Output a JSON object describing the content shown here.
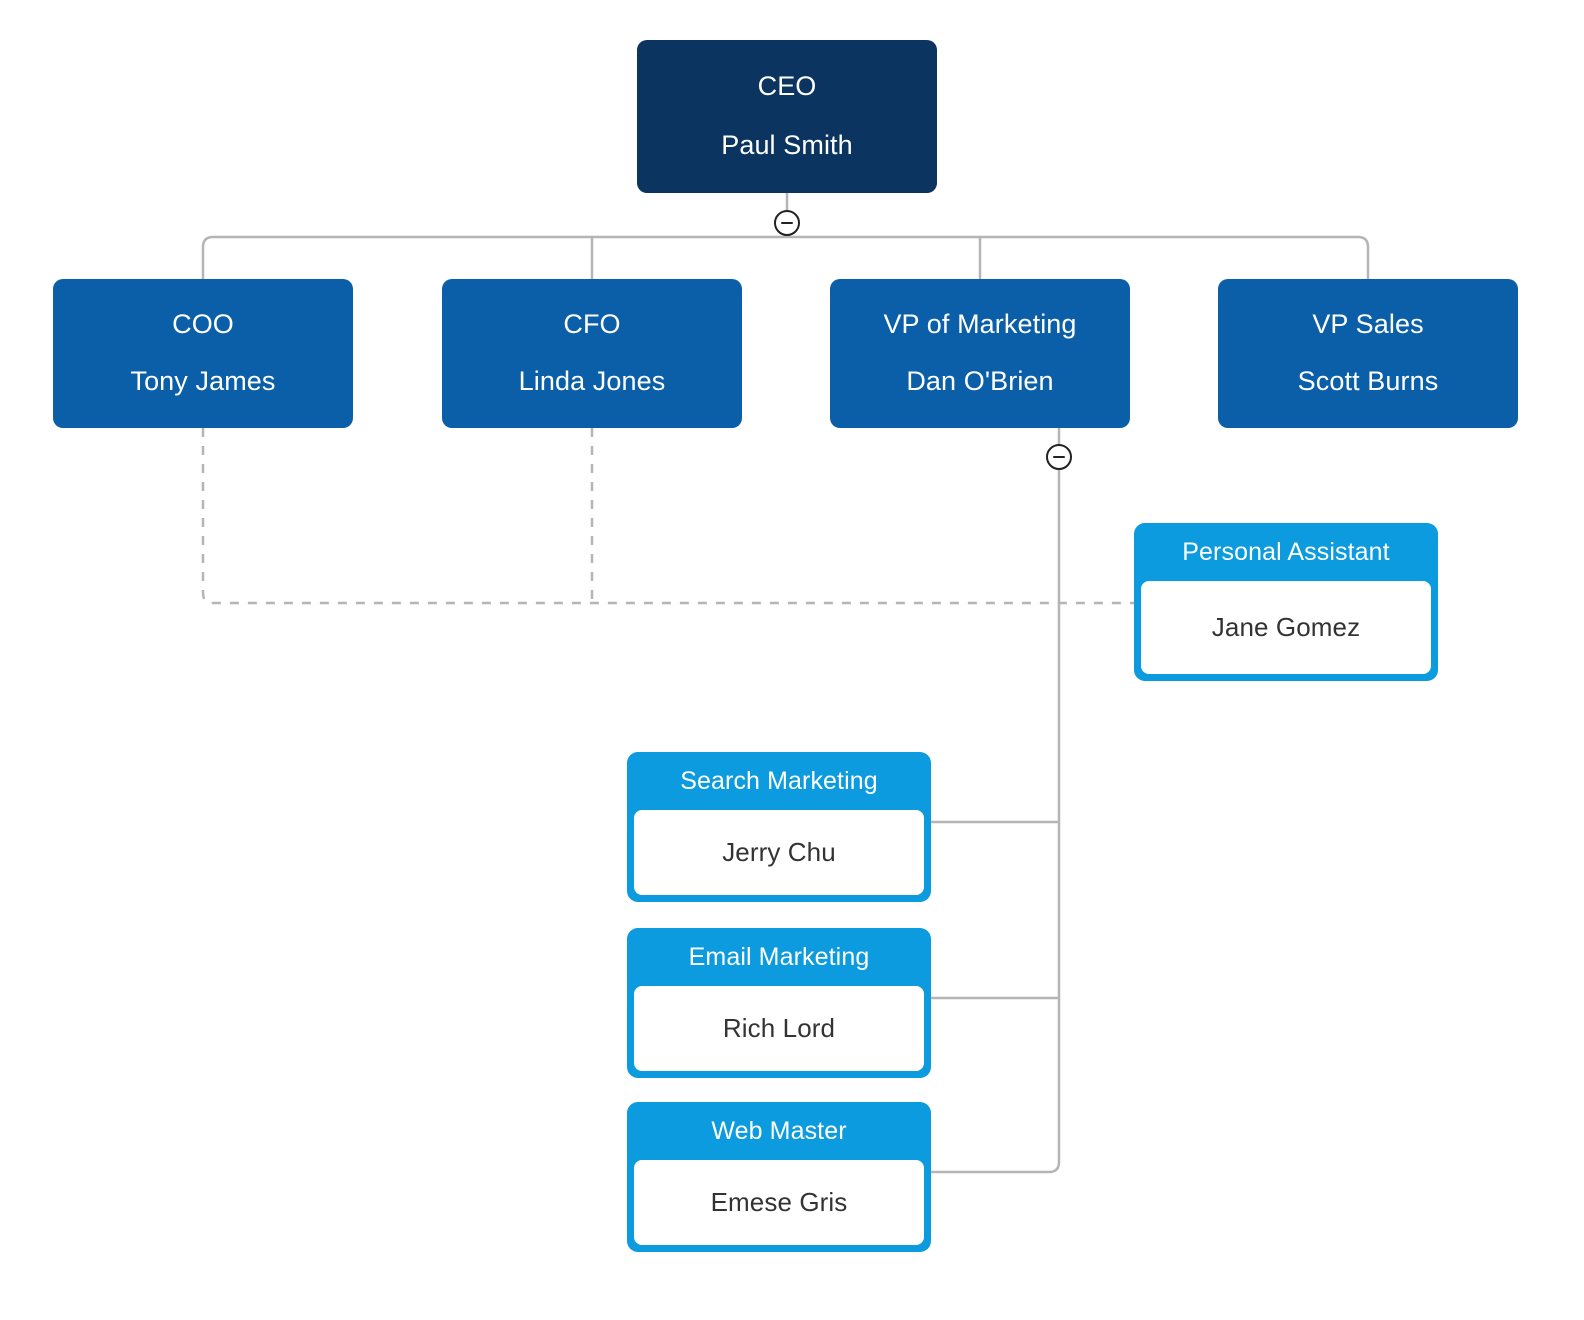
{
  "chart": {
    "type": "org-chart",
    "background_color": "#ffffff",
    "colors": {
      "root": "#0b3460",
      "level2": "#0b5fa8",
      "leaf": "#0c9bde",
      "leaf_body": "#ffffff",
      "connector": "#b5b5b5",
      "assistant_connector": "#b5b5b5",
      "title_text": "#ffffff",
      "name_text": "#333333"
    }
  },
  "nodes": {
    "ceo": {
      "title": "CEO",
      "name": "Paul Smith",
      "style": "root"
    },
    "coo": {
      "title": "COO",
      "name": "Tony James",
      "style": "level2"
    },
    "cfo": {
      "title": "CFO",
      "name": "Linda Jones",
      "style": "level2"
    },
    "vp_marketing": {
      "title": "VP of Marketing",
      "name": "Dan O'Brien",
      "style": "level2"
    },
    "vp_sales": {
      "title": "VP Sales",
      "name": "Scott Burns",
      "style": "level2"
    },
    "personal_assistant": {
      "title": "Personal Assistant",
      "name": "Jane Gomez",
      "style": "leaf"
    },
    "search_marketing": {
      "title": "Search Marketing",
      "name": "Jerry Chu",
      "style": "leaf"
    },
    "email_marketing": {
      "title": "Email Marketing",
      "name": "Rich Lord",
      "style": "leaf"
    },
    "web_master": {
      "title": "Web Master",
      "name": "Emese Gris",
      "style": "leaf"
    }
  },
  "toggles": {
    "ceo_toggle": {
      "icon": "minus-circle-icon",
      "state": "expanded"
    },
    "vp_marketing_toggle": {
      "icon": "minus-circle-icon",
      "state": "expanded"
    }
  }
}
